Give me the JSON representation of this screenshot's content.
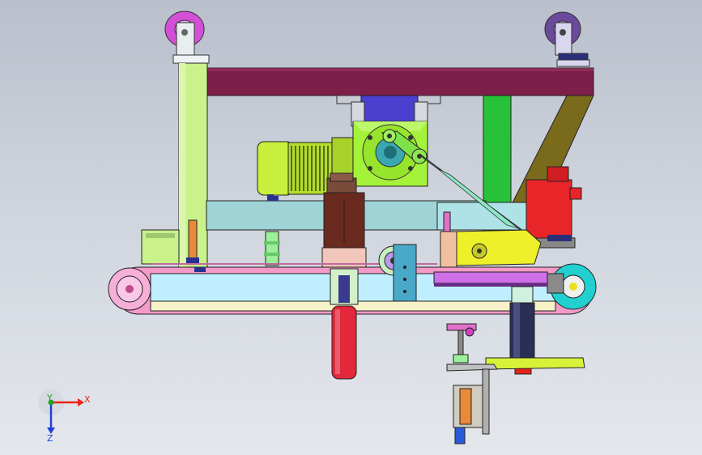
{
  "triad": {
    "x_label": "X",
    "y_label": "Y",
    "z_label": "Z",
    "x_color": "#e8261c",
    "y_color": "#1fa32a",
    "z_color": "#2040d8"
  },
  "colors": {
    "frame_top": "#7e1f4a",
    "frame_column_left": "#c9f28a",
    "frame_column_right": "#28c23a",
    "diagonal_brace": "#7a6a1c",
    "motor_green": "#c8ef3c",
    "gearbox_blue": "#4b3fd0",
    "gearbox_green": "#a4f23a",
    "conveyor_frame": "#f39ac8",
    "conveyor_inner": "#bfefff",
    "servo_red": "#e8262a",
    "cylinder_red": "#e3283c",
    "cylinder_dark": "#2a2f55",
    "bracket_yellow": "#eef02a",
    "cyan_pulley": "#22d0d0",
    "caster_magenta": "#d44fd8",
    "caster_purple": "#6a4a9a"
  }
}
